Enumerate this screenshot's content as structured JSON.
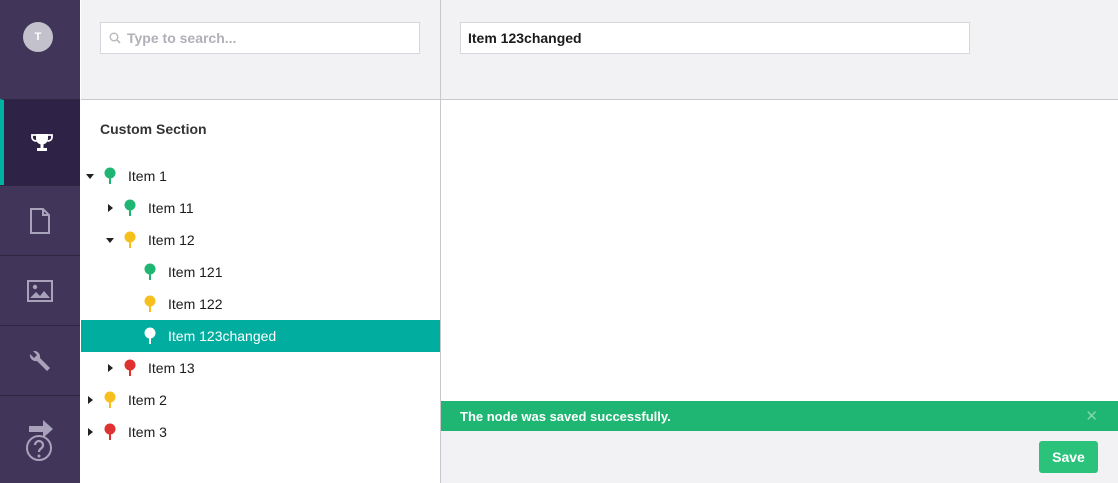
{
  "user": {
    "avatar_initial": "T"
  },
  "nav": [
    {
      "name": "trophy-icon",
      "active": true
    },
    {
      "name": "document-icon",
      "active": false
    },
    {
      "name": "image-icon",
      "active": false
    },
    {
      "name": "wrench-icon",
      "active": false
    },
    {
      "name": "help-icon",
      "active": false
    }
  ],
  "search": {
    "placeholder": "Type to search...",
    "value": ""
  },
  "tree": {
    "section_title": "Custom Section",
    "items": [
      {
        "label": "Item 1",
        "caret": "down",
        "color": "#1fb572",
        "depth": 0
      },
      {
        "label": "Item 11",
        "caret": "right",
        "color": "#1fb572",
        "depth": 1
      },
      {
        "label": "Item 12",
        "caret": "down",
        "color": "#f5c01e",
        "depth": 1
      },
      {
        "label": "Item 121",
        "caret": "none",
        "color": "#1fb572",
        "depth": 2
      },
      {
        "label": "Item 122",
        "caret": "none",
        "color": "#f5c01e",
        "depth": 2
      },
      {
        "label": "Item 123changed",
        "caret": "none",
        "color": "#ffffff",
        "depth": 2,
        "selected": true
      },
      {
        "label": "Item 13",
        "caret": "right",
        "color": "#e03131",
        "depth": 1
      },
      {
        "label": "Item 2",
        "caret": "right",
        "color": "#f5c01e",
        "depth": 0
      },
      {
        "label": "Item 3",
        "caret": "right",
        "color": "#e03131",
        "depth": 0
      }
    ]
  },
  "editor": {
    "name_value": "Item 123changed"
  },
  "notification": {
    "text": "The node was saved successfully.",
    "close_glyph": "✕"
  },
  "footer": {
    "save_label": "Save"
  },
  "colors": {
    "accent": "#00ad9f",
    "success": "#1fb572",
    "rail": "#413659"
  }
}
